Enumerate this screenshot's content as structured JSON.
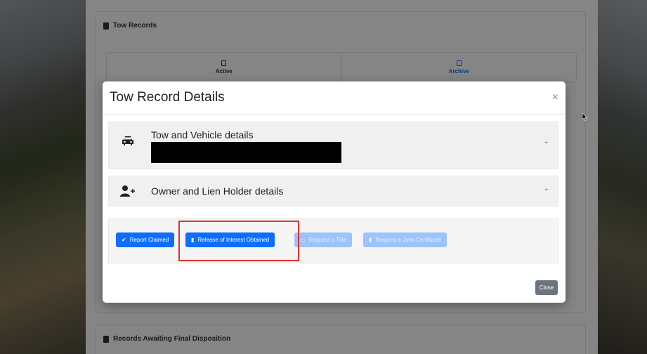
{
  "page": {
    "tow_records_title": "Tow Records",
    "tabs": [
      {
        "label": "Active"
      },
      {
        "label": "Archive"
      }
    ],
    "awaiting_title": "Records Awaiting Final Disposition"
  },
  "modal": {
    "title": "Tow Record Details",
    "close_x": "×",
    "sections": [
      {
        "title": "Tow and Vehicle details",
        "icon": "car-icon"
      },
      {
        "title": "Owner and Lien Holder details",
        "icon": "user-plus-icon"
      }
    ],
    "chevron": "⌄",
    "actions": [
      {
        "label": "Report Claimed",
        "icon": "check-icon",
        "glyph": "✔",
        "state": "enabled"
      },
      {
        "label": "Release of Interest Obtained",
        "icon": "document-icon",
        "glyph": "▮",
        "state": "enabled"
      },
      {
        "label": "Request a Title",
        "icon": "id-card-icon",
        "glyph": "▭",
        "state": "disabled"
      },
      {
        "label": "Request a Junk Certificate",
        "icon": "document-icon",
        "glyph": "▮",
        "state": "disabled"
      }
    ],
    "close_label": "Close"
  },
  "colors": {
    "primary": "#0d6efd",
    "disabled": "#9dc3fb",
    "highlight": "#e0312f",
    "secondary": "#6c757d"
  }
}
